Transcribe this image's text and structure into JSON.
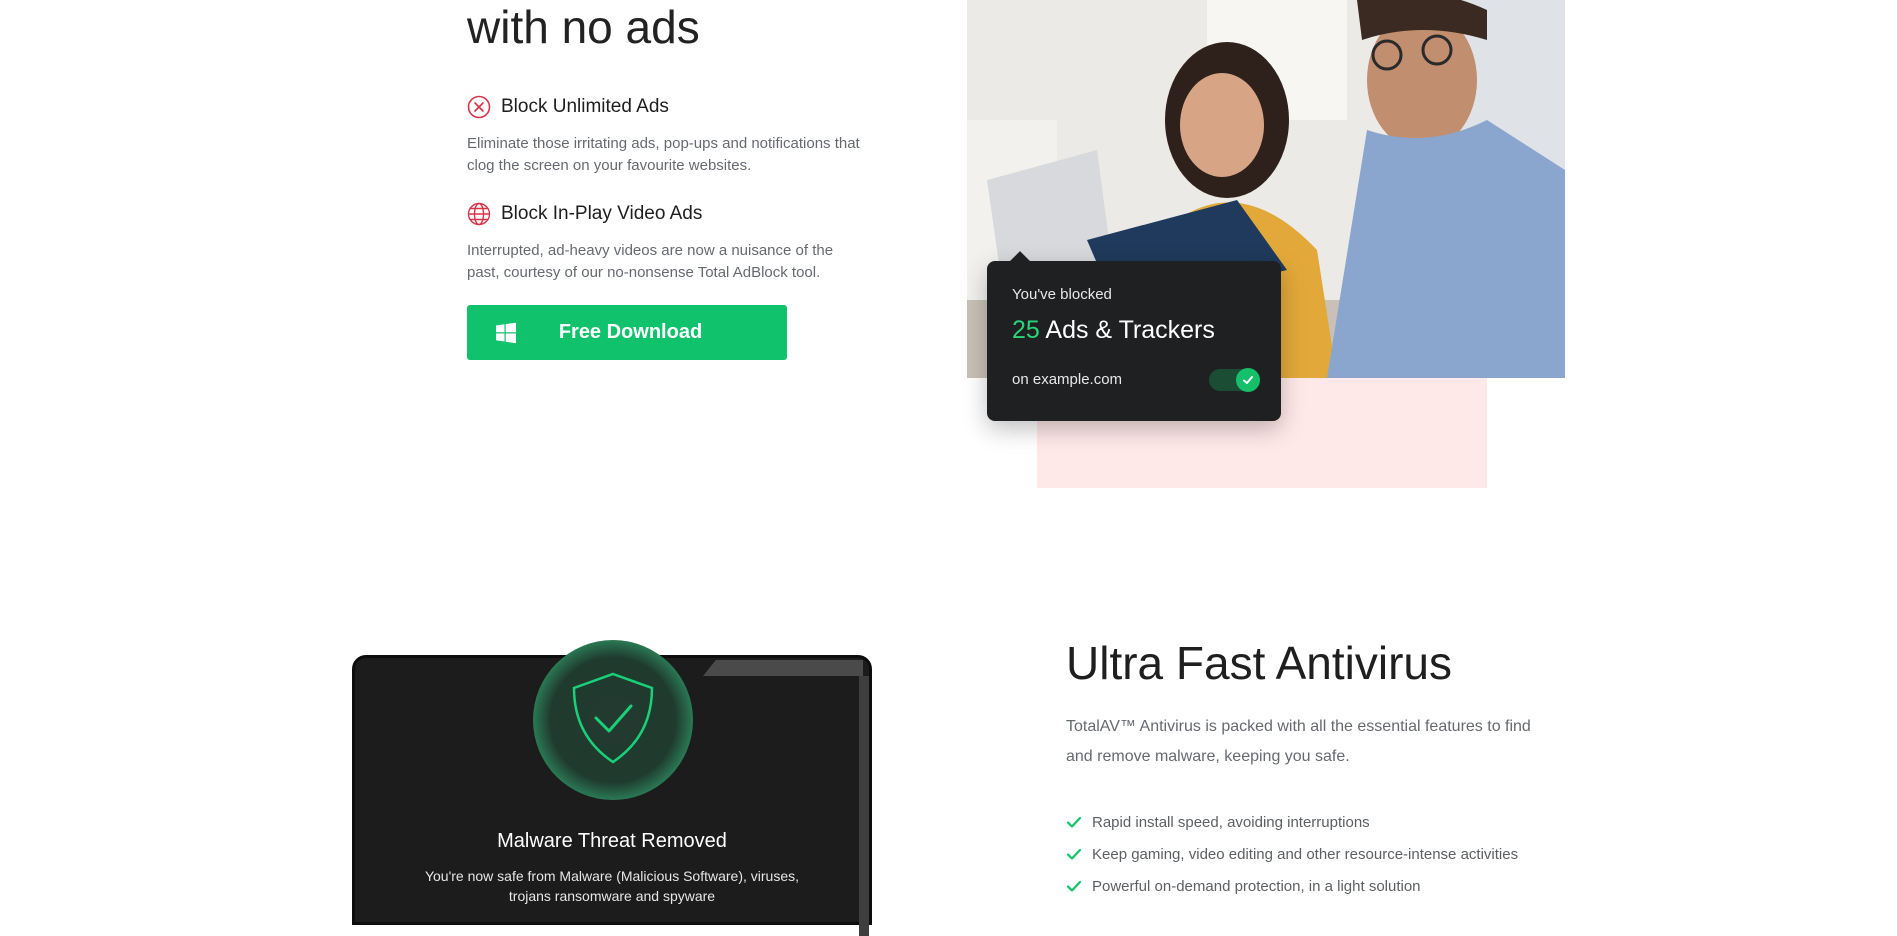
{
  "adblock": {
    "headline_tail": "with no ads",
    "features": [
      {
        "title": "Block Unlimited Ads",
        "icon": "block-circle-x-icon",
        "desc": "Eliminate those irritating ads, pop-ups and notifications that clog the screen on your favourite websites."
      },
      {
        "title": "Block In-Play Video Ads",
        "icon": "globe-icon",
        "desc": "Interrupted, ad-heavy videos are now a nuisance of the past, courtesy of our no-nonsense Total AdBlock tool."
      }
    ],
    "download_label": "Free Download"
  },
  "popup": {
    "blocked_label": "You've blocked",
    "count": "25",
    "count_suffix": "Ads & Trackers",
    "domain": "on example.com",
    "toggle_on": true
  },
  "laptop": {
    "title": "Malware Threat Removed",
    "desc": "You're now safe from Malware (Malicious Software), viruses, trojans ransomware and spyware"
  },
  "antivirus": {
    "title": "Ultra Fast Antivirus",
    "desc": "TotalAV™ Antivirus is packed with all the essential features to find and remove malware, keeping you safe.",
    "bullets": [
      "Rapid install speed, avoiding interruptions",
      "Keep gaming, video editing and other resource-intense activities",
      "Powerful on-demand protection, in a light solution"
    ]
  },
  "colors": {
    "accent_green": "#10c26b",
    "icon_red": "#d9334a",
    "popup_bg": "#1f2022",
    "pink_block": "#ffe8e8"
  }
}
